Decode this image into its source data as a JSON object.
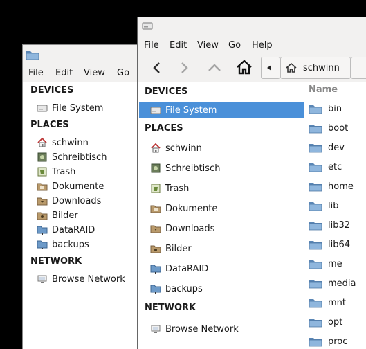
{
  "menu": [
    "File",
    "Edit",
    "View",
    "Go",
    "Help"
  ],
  "sections": {
    "devices": "DEVICES",
    "places": "PLACES",
    "network": "NETWORK"
  },
  "devices": [
    {
      "label": "File System",
      "icon": "drive-icon"
    }
  ],
  "places": [
    {
      "label": "schwinn",
      "icon": "home-folder-icon"
    },
    {
      "label": "Schreibtisch",
      "icon": "desktop-icon"
    },
    {
      "label": "Trash",
      "icon": "trash-icon"
    },
    {
      "label": "Dokumente",
      "icon": "documents-folder-icon"
    },
    {
      "label": "Downloads",
      "icon": "downloads-folder-icon"
    },
    {
      "label": "Bilder",
      "icon": "pictures-folder-icon"
    },
    {
      "label": "DataRAID",
      "icon": "network-folder-icon"
    },
    {
      "label": "backups",
      "icon": "network-folder-icon"
    }
  ],
  "network": [
    {
      "label": "Browse Network",
      "icon": "network-icon"
    }
  ],
  "breadcrumb": {
    "current": "schwinn"
  },
  "filelist": {
    "column_name": "Name",
    "rows": [
      "bin",
      "boot",
      "dev",
      "etc",
      "home",
      "lib",
      "lib32",
      "lib64",
      "me",
      "media",
      "mnt",
      "opt",
      "proc"
    ]
  },
  "colors": {
    "selection": "#4a90d9",
    "folder": "#6d9ac8",
    "background": "#000000"
  }
}
